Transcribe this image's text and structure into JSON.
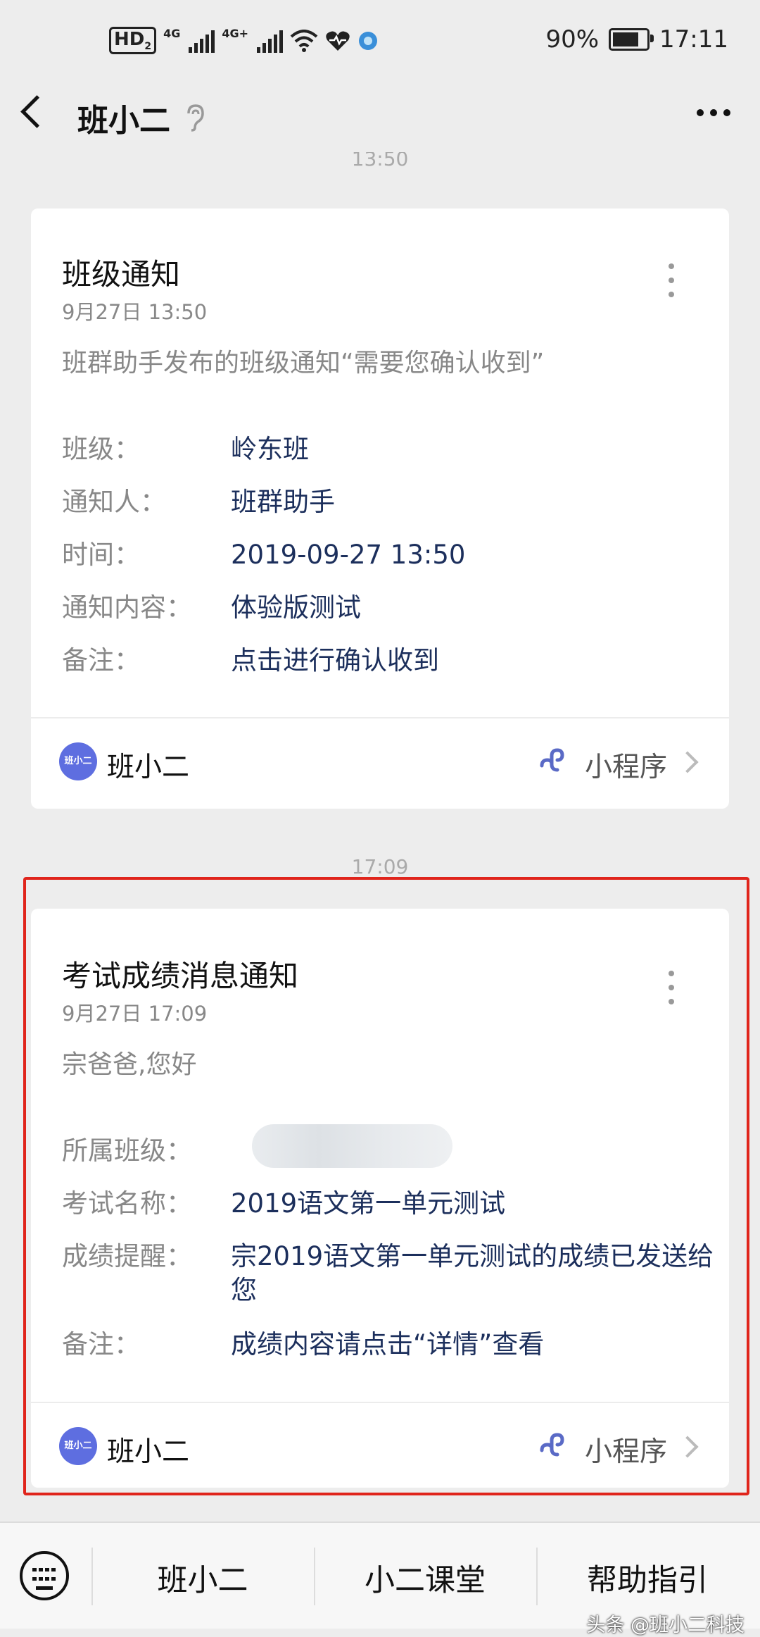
{
  "status_bar": {
    "hd": "HD",
    "hd_sub": "2",
    "sig1_label": "4G",
    "sig2_label": "4G+",
    "battery_percent": "90%",
    "battery_level": 0.9,
    "time": "17:11"
  },
  "nav": {
    "title": "班小二"
  },
  "timestamps": {
    "top_partial": "13:50",
    "second": "17:09"
  },
  "card1": {
    "title": "班级通知",
    "date": "9月27日 13:50",
    "intro": "班群助手发布的班级通知“需要您确认收到”",
    "rows": [
      {
        "key": "班级：",
        "value": "岭东班"
      },
      {
        "key": "通知人：",
        "value": "班群助手"
      },
      {
        "key": "时间：",
        "value": "2019-09-27 13:50"
      },
      {
        "key": "通知内容：",
        "value": "体验版测试"
      },
      {
        "key": "备注：",
        "value": "点击进行确认收到"
      }
    ],
    "footer_name": "班小二",
    "footer_link": "小程序"
  },
  "card2": {
    "title": "考试成绩消息通知",
    "date": "9月27日 17:09",
    "intro": "宗爸爸,您好",
    "rows": [
      {
        "key": "所属班级：",
        "value": ""
      },
      {
        "key": "考试名称：",
        "value": "2019语文第一单元测试"
      },
      {
        "key": "成绩提醒：",
        "value": "宗2019语文第一单元测试的成绩已发送给您"
      },
      {
        "key": "备注：",
        "value": "成绩内容请点击“详情”查看"
      }
    ],
    "footer_name": "班小二",
    "footer_link": "小程序"
  },
  "logo_text": "班小二",
  "tabbar": {
    "tabs": [
      "班小二",
      "小二课堂",
      "帮助指引"
    ]
  },
  "watermark": "头条 @班小二科技",
  "colors": {
    "highlight_border": "#e0251c",
    "value_text": "#1c2f5c",
    "logo_bg": "#5e6ee0"
  }
}
